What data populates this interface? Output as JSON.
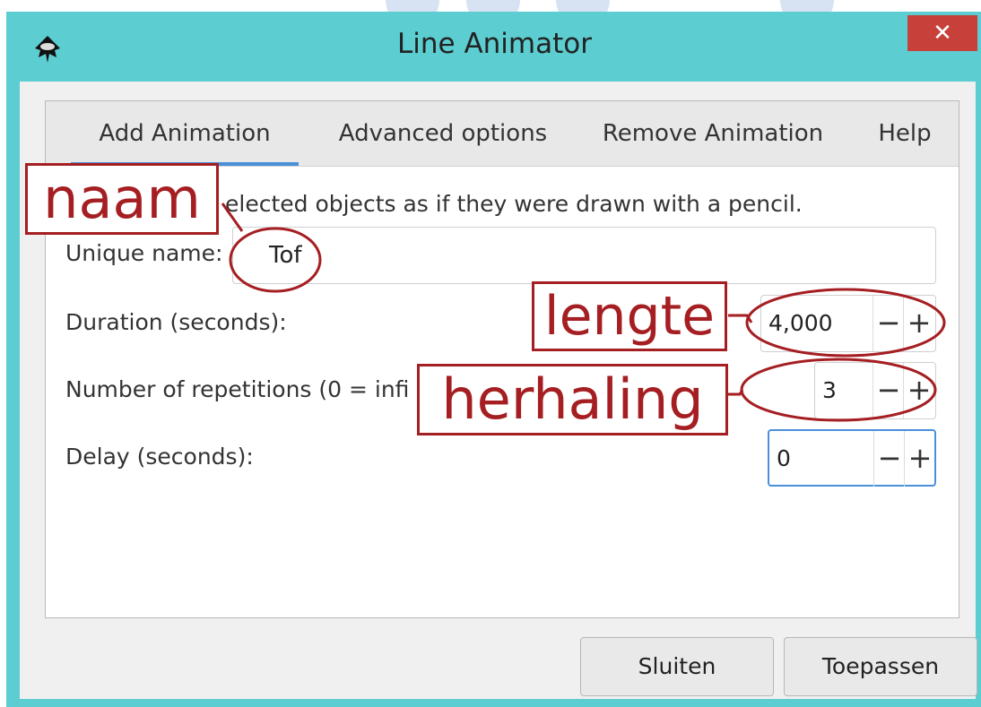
{
  "window": {
    "title": "Line Animator",
    "close_glyph": "✕",
    "app_icon": "inkscape-icon",
    "titlebar_color": "#5ccdd0",
    "close_color": "#c7403a"
  },
  "tabs": [
    {
      "label": "Add Animation",
      "active": true
    },
    {
      "label": "Advanced options",
      "active": false
    },
    {
      "label": "Remove Animation",
      "active": false
    },
    {
      "label": "Help",
      "active": false
    }
  ],
  "form": {
    "description": "elected objects as if they were drawn with a pencil.",
    "unique_name_label": "Unique name:",
    "unique_name_value": "Tof",
    "duration_label": "Duration (seconds):",
    "duration_value": "4,000",
    "repetitions_label": "Number of repetitions (0 = infi",
    "repetitions_value": "3",
    "delay_label": "Delay (seconds):",
    "delay_value": "0",
    "minus_glyph": "−",
    "plus_glyph": "+"
  },
  "footer": {
    "close_label": "Sluiten",
    "apply_label": "Toepassen"
  },
  "annotations": {
    "name": "naam",
    "duration": "lengte",
    "repetitions": "herhaling",
    "color": "#a51e22"
  }
}
